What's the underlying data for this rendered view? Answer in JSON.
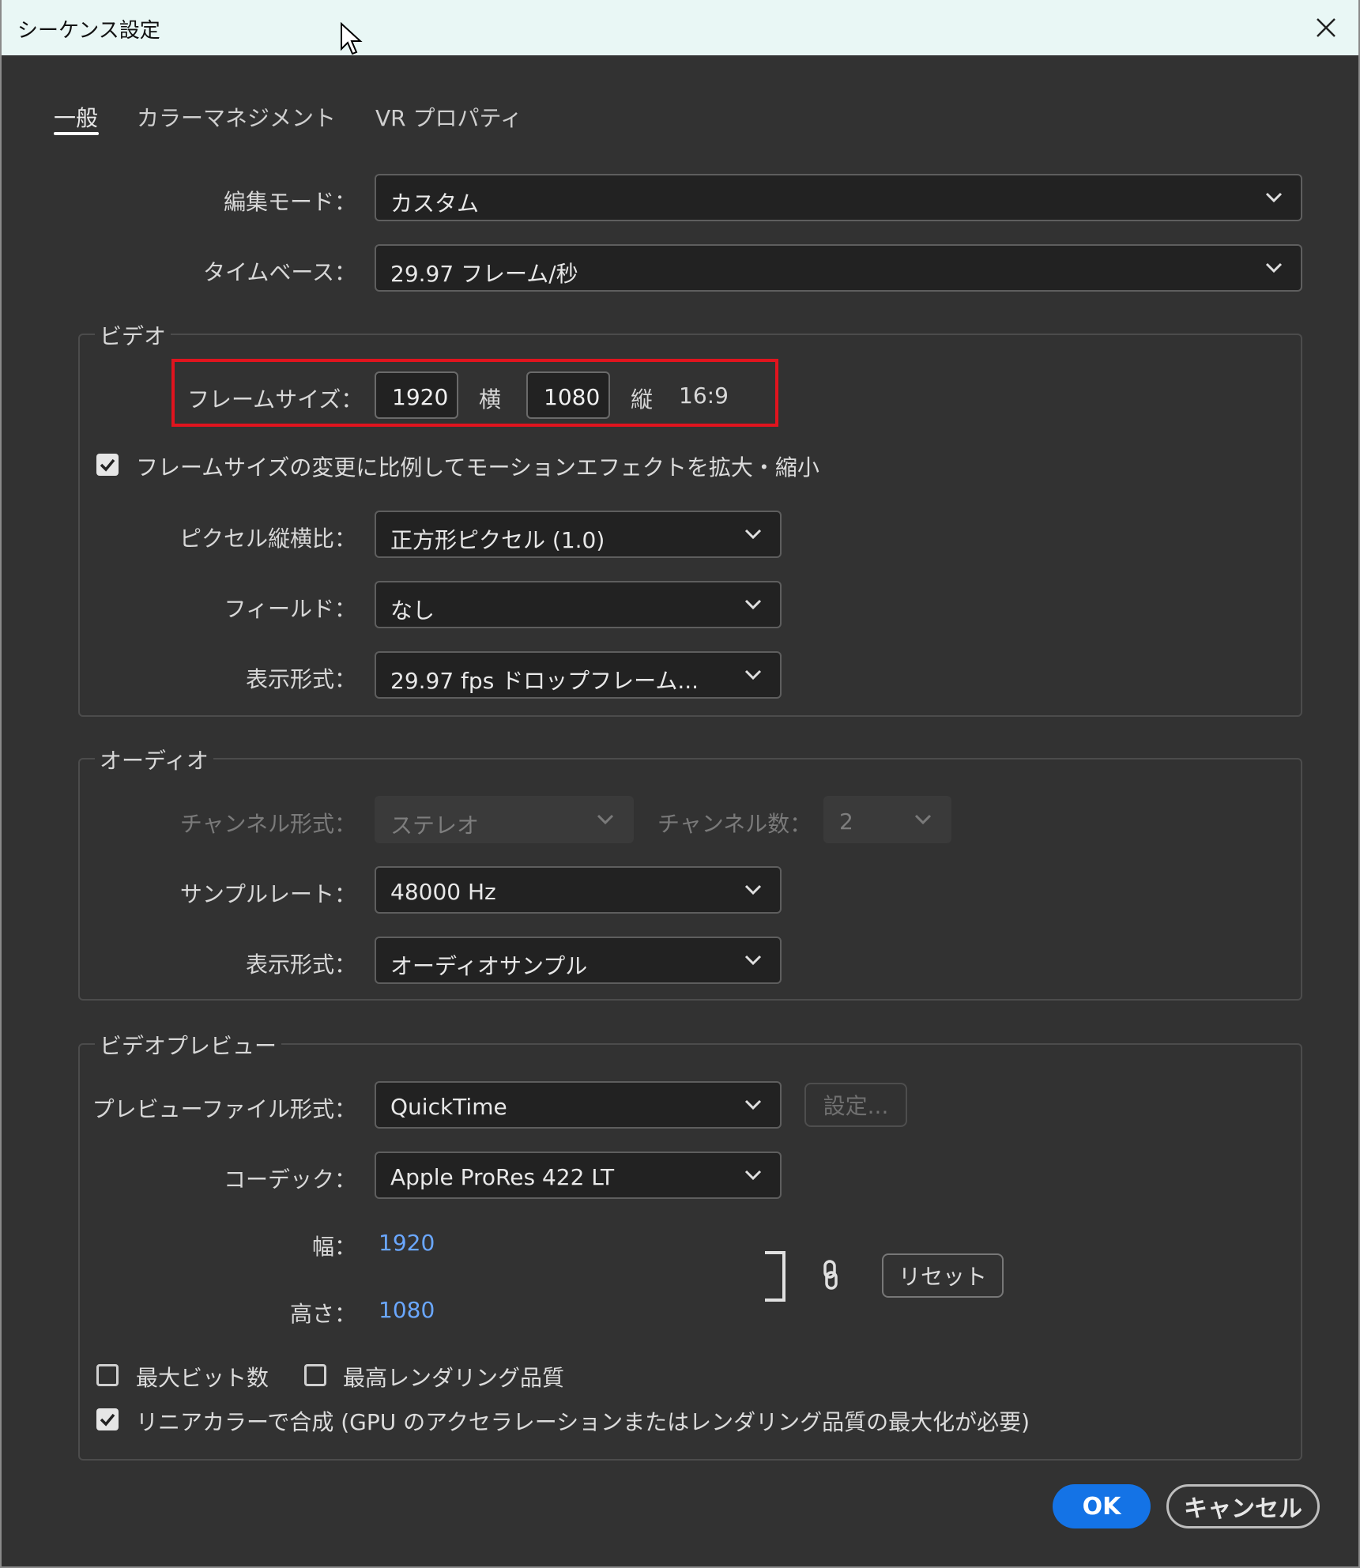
{
  "window": {
    "title": "シーケンス設定"
  },
  "tabs": [
    {
      "label": "一般"
    },
    {
      "label": "カラーマネジメント"
    },
    {
      "label": "VR プロパティ"
    }
  ],
  "general": {
    "edit_mode_label": "編集モード：",
    "edit_mode_value": "カスタム",
    "timebase_label": "タイムベース：",
    "timebase_value": "29.97  フレーム/秒"
  },
  "video": {
    "group_title": "ビデオ",
    "frame_size_label": "フレームサイズ：",
    "width_value": "1920",
    "horizontal_label": "横",
    "height_value": "1080",
    "vertical_label": "縦",
    "aspect_ratio": "16:9",
    "scale_motion_checkbox": "フレームサイズの変更に比例してモーションエフェクトを拡大・縮小",
    "pixel_aspect_label": "ピクセル縦横比：",
    "pixel_aspect_value": "正方形ピクセル (1.0)",
    "fields_label": "フィールド：",
    "fields_value": "なし",
    "display_format_label": "表示形式：",
    "display_format_value": "29.97 fps ドロップフレーム..."
  },
  "audio": {
    "group_title": "オーディオ",
    "channel_format_label": "チャンネル形式：",
    "channel_format_value": "ステレオ",
    "channel_count_label": "チャンネル数：",
    "channel_count_value": "2",
    "sample_rate_label": "サンプルレート：",
    "sample_rate_value": "48000 Hz",
    "display_format_label": "表示形式：",
    "display_format_value": "オーディオサンプル"
  },
  "video_preview": {
    "group_title": "ビデオプレビュー",
    "file_format_label": "プレビューファイル形式：",
    "file_format_value": "QuickTime",
    "settings_button": "設定...",
    "codec_label": "コーデック：",
    "codec_value": "Apple ProRes 422 LT",
    "width_label": "幅：",
    "width_value": "1920",
    "height_label": "高さ：",
    "height_value": "1080",
    "reset_button": "リセット",
    "max_bit_depth": "最大ビット数",
    "max_render_quality": "最高レンダリング品質",
    "linear_color": "リニアカラーで合成 (GPU のアクセラレーションまたはレンダリング品質の最大化が必要)"
  },
  "footer": {
    "ok": "OK",
    "cancel": "キャンセル"
  },
  "colors": {
    "accent": "#1473e6",
    "highlight_box": "#e0141e",
    "link_value": "#6aa7ff"
  }
}
